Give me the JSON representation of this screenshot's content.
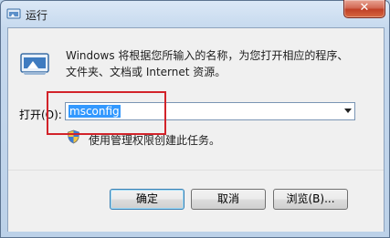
{
  "window": {
    "title": "运行",
    "close_symbol": "✕"
  },
  "description": {
    "line1": "Windows 将根据您所输入的名称，为您打开相应的程序、",
    "line2": "文件夹、文档或 Internet 资源。"
  },
  "open_field": {
    "label": "打开(O):",
    "value": "msconfig"
  },
  "admin_note": "使用管理权限创建此任务。",
  "buttons": {
    "ok": "确定",
    "cancel": "取消",
    "browse": "浏览(B)..."
  },
  "colors": {
    "highlight": "#d2232a",
    "selection": "#3399ff",
    "close": "#c04026"
  },
  "icons": {
    "title": "run-icon",
    "app": "run-program-icon",
    "shield": "uac-shield-icon"
  }
}
